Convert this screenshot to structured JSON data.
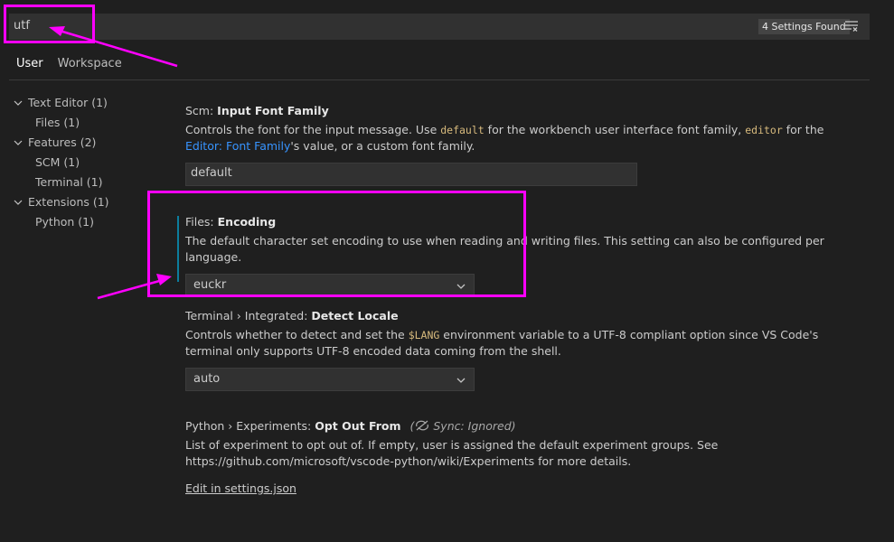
{
  "search": {
    "value": "utf",
    "results_badge": "4 Settings Found",
    "filter_icon": "clear-filter-icon"
  },
  "tabs": [
    {
      "label": "User",
      "active": true
    },
    {
      "label": "Workspace",
      "active": false
    }
  ],
  "toc": [
    {
      "label": "Text Editor (1)",
      "expanded": true,
      "level": 0
    },
    {
      "label": "Files (1)",
      "level": 1
    },
    {
      "label": "Features (2)",
      "expanded": true,
      "level": 0
    },
    {
      "label": "SCM (1)",
      "level": 1
    },
    {
      "label": "Terminal (1)",
      "level": 1
    },
    {
      "label": "Extensions (1)",
      "expanded": true,
      "level": 0
    },
    {
      "label": "Python (1)",
      "level": 1
    }
  ],
  "settings": {
    "scm_font": {
      "category": "Scm: ",
      "name": "Input Font Family",
      "desc_1": "Controls the font for the input message. Use ",
      "code_1": "default",
      "desc_2": " for the workbench user interface font family, ",
      "code_2": "editor",
      "desc_3": " for the ",
      "link": "Editor: Font Family",
      "desc_4": "'s value, or a custom font family.",
      "value": "default"
    },
    "files_encoding": {
      "category": "Files: ",
      "name": "Encoding",
      "desc": "The default character set encoding to use when reading and writing files. This setting can also be configured per language.",
      "value": "euckr"
    },
    "terminal_locale": {
      "category": "Terminal › Integrated: ",
      "name": "Detect Locale",
      "desc_1": "Controls whether to detect and set the ",
      "code": "$LANG",
      "desc_2": " environment variable to a UTF-8 compliant option since VS Code's terminal only supports UTF-8 encoded data coming from the shell.",
      "value": "auto"
    },
    "python_experiments": {
      "category": "Python › Experiments: ",
      "name": "Opt Out From",
      "sync_label": "Sync: Ignored",
      "desc": "List of experiment to opt out of. If empty, user is assigned the default experiment groups. See https://github.com/microsoft/vscode-python/wiki/Experiments for more details.",
      "edit_link": "Edit in settings.json"
    }
  },
  "colors": {
    "annotation": "#ff00ff",
    "modified_indicator": "#0c7d9d",
    "link": "#3794ff"
  }
}
